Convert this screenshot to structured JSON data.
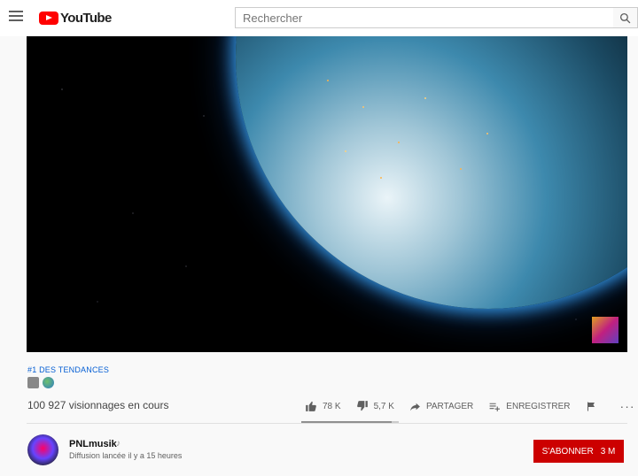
{
  "header": {
    "logo_text": "YouTube",
    "search_placeholder": "Rechercher",
    "icons": [
      "menu-icon",
      "youtube-logo-icon",
      "search-icon"
    ]
  },
  "video": {
    "thumbnail_description": "earth-at-night-from-space"
  },
  "meta": {
    "trending": "#1 DES TENDANCES",
    "emojis": [
      "satellite-icon",
      "globe-icon"
    ],
    "views": "100 927 visionnages en cours"
  },
  "actions": {
    "likes": "78 K",
    "dislikes": "5,7 K",
    "share": "PARTAGER",
    "save": "ENREGISTRER",
    "more": "···",
    "like_ratio": 0.93
  },
  "channel": {
    "name": "PNLmusik",
    "note": "♪",
    "stream_info": "Diffusion lancée il y a 15 heures",
    "subscribe_label": "S'ABONNER",
    "subscriber_count": "3 M"
  },
  "colors": {
    "accent": "#cc0000",
    "link": "#065fd4"
  }
}
